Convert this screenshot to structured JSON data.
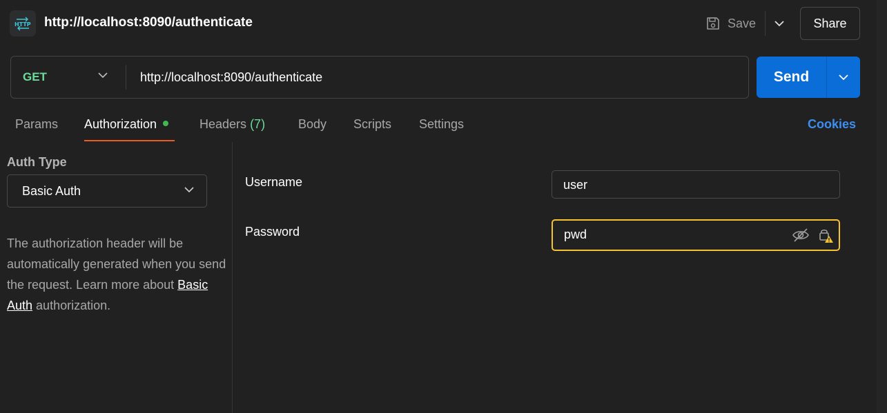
{
  "header": {
    "badge_icon": "http-icon",
    "title": "http://localhost:8090/authenticate",
    "save_label": "Save",
    "share_label": "Share"
  },
  "request": {
    "method": "GET",
    "url": "http://localhost:8090/authenticate",
    "send_label": "Send"
  },
  "tabs": {
    "items": [
      {
        "label": "Params"
      },
      {
        "label": "Authorization"
      },
      {
        "label": "Headers",
        "count": "(7)"
      },
      {
        "label": "Body"
      },
      {
        "label": "Scripts"
      },
      {
        "label": "Settings"
      }
    ],
    "active": "Authorization",
    "cookies_label": "Cookies"
  },
  "auth": {
    "type_label": "Auth Type",
    "type_value": "Basic Auth",
    "description_prefix": "The authorization header will be automatically generated when you send the request. Learn more about",
    "description_link": "Basic Auth",
    "description_suffix": "authorization.",
    "username_label": "Username",
    "username_value": "user",
    "password_label": "Password",
    "password_value": "pwd"
  },
  "colors": {
    "background": "#212121",
    "method_get": "#6bdd9a",
    "send_button": "#0b6ed8",
    "active_tab_underline": "#ef5b25",
    "auth_dot": "#3fb950",
    "cookies_link": "#3d8ef0",
    "focus_border": "#f6c432",
    "warning_icon": "#f6c432"
  }
}
